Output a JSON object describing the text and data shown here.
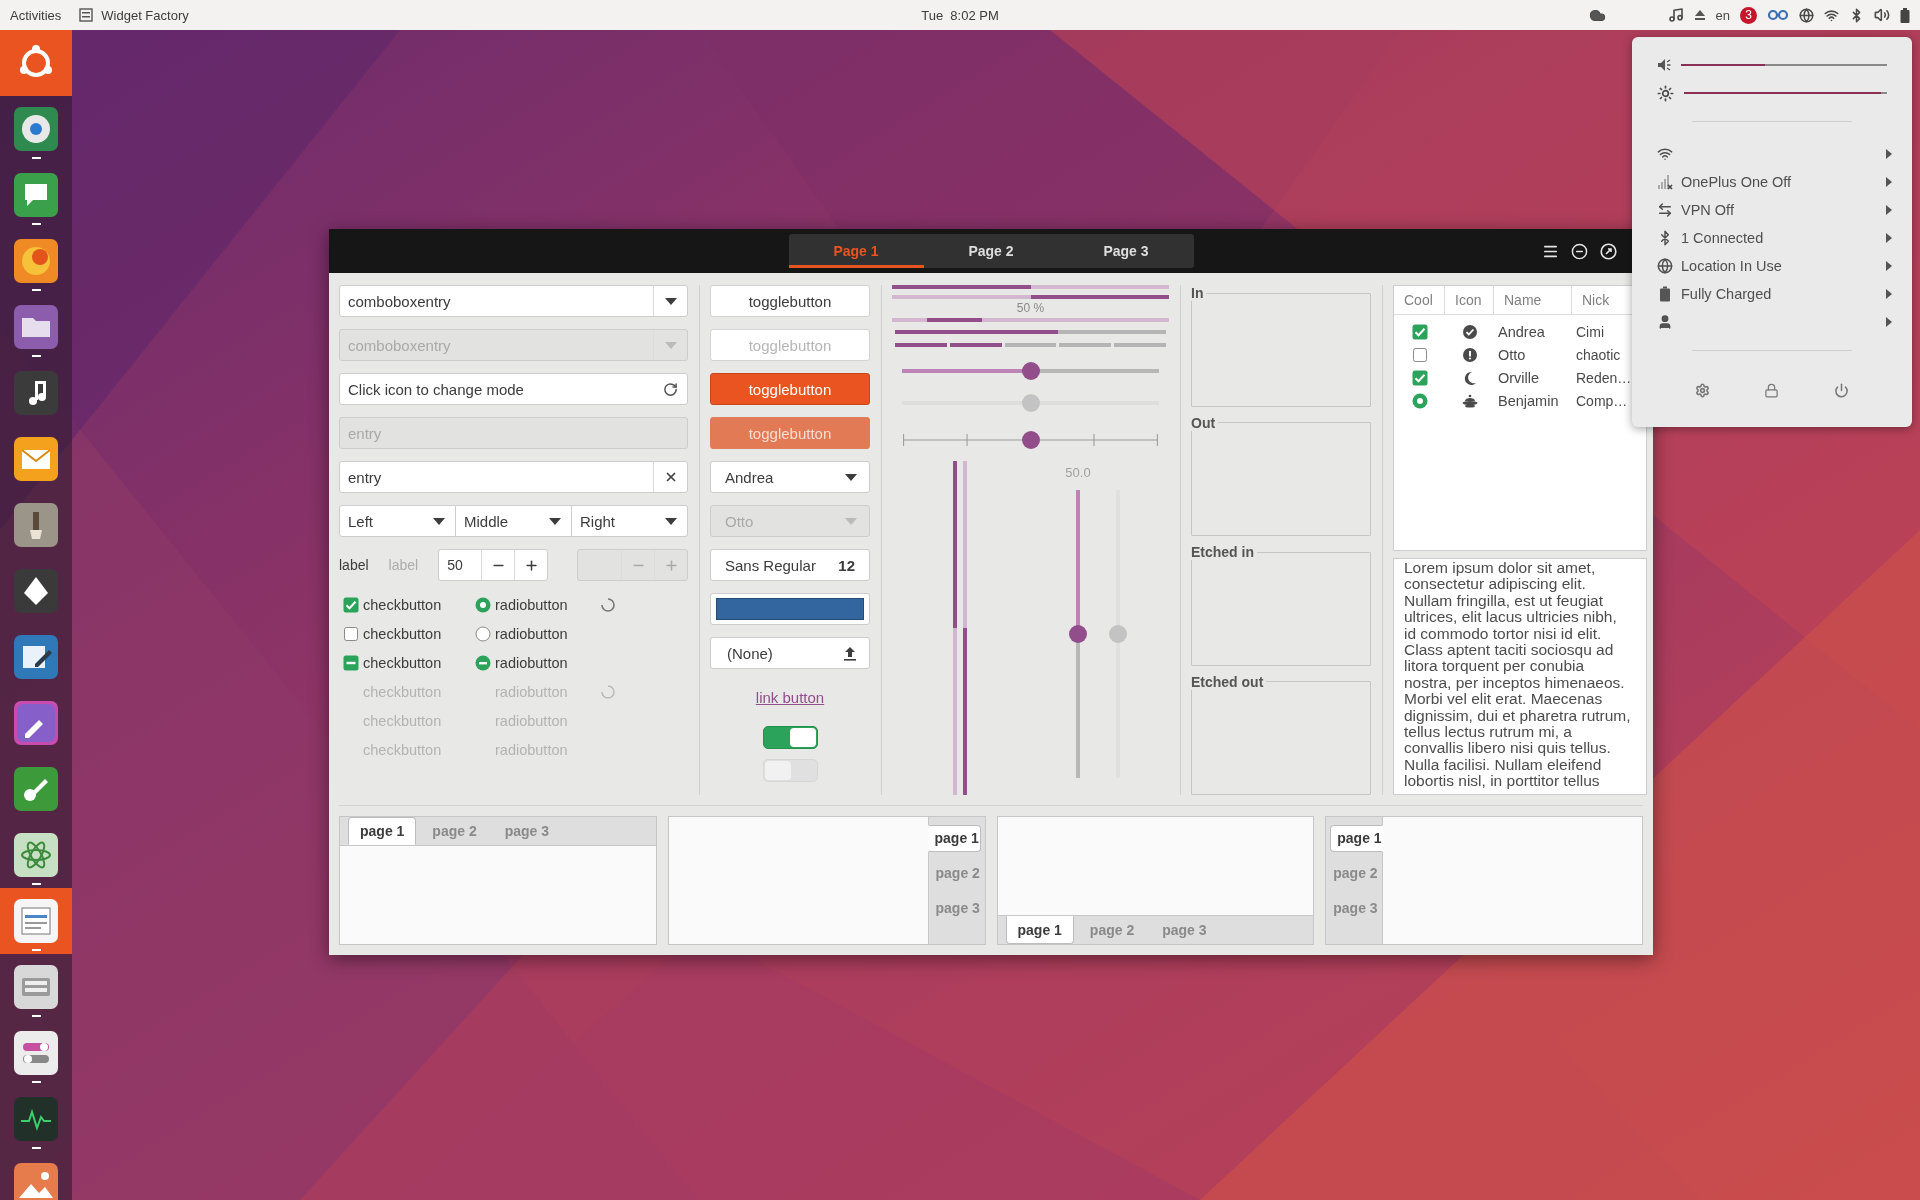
{
  "top_bar": {
    "activities": "Activities",
    "app_menu": "Widget Factory",
    "clock": "Tue  8:02 PM",
    "keyboard_layout": "en",
    "notification_badge": "3"
  },
  "launcher": [
    {
      "kind": "home",
      "running": false
    },
    {
      "kind": "app",
      "running": true,
      "focused": false
    },
    {
      "kind": "app",
      "running": true,
      "focused": false
    },
    {
      "kind": "app",
      "running": true,
      "focused": false
    },
    {
      "kind": "app",
      "running": true,
      "focused": false
    },
    {
      "kind": "app",
      "running": false,
      "focused": false
    },
    {
      "kind": "app",
      "running": false,
      "focused": false
    },
    {
      "kind": "app",
      "running": false,
      "focused": false
    },
    {
      "kind": "app",
      "running": false,
      "focused": false
    },
    {
      "kind": "app",
      "running": false,
      "focused": false
    },
    {
      "kind": "app",
      "running": false,
      "focused": false
    },
    {
      "kind": "app",
      "running": false,
      "focused": false
    },
    {
      "kind": "app",
      "running": true,
      "focused": false
    },
    {
      "kind": "app",
      "running": true,
      "focused": true
    },
    {
      "kind": "app",
      "running": true,
      "focused": false
    },
    {
      "kind": "app",
      "running": true,
      "focused": false
    },
    {
      "kind": "app",
      "running": true,
      "focused": false
    },
    {
      "kind": "app",
      "focused": false
    }
  ],
  "window": {
    "tabs": [
      {
        "label": "Page 1",
        "selected": true
      },
      {
        "label": "Page 2",
        "selected": false
      },
      {
        "label": "Page 3",
        "selected": false
      }
    ]
  },
  "combo_entries": [
    {
      "value": "comboboxentry",
      "disabled": false
    },
    {
      "value": "comboboxentry",
      "disabled": true
    }
  ],
  "entries": [
    {
      "kind": "icon",
      "value": "Click icon to change mode",
      "disabled": false
    },
    {
      "kind": "plain",
      "value": "entry",
      "disabled": true
    },
    {
      "kind": "clear",
      "value": "entry",
      "disabled": false
    }
  ],
  "linked_combos": [
    {
      "label": "Left"
    },
    {
      "label": "Middle"
    },
    {
      "label": "Right"
    }
  ],
  "labels": [
    {
      "text": "label",
      "disabled": false
    },
    {
      "text": "label",
      "disabled": true
    }
  ],
  "spin_buttons": [
    {
      "value": "50",
      "disabled": false
    },
    {
      "disabled": true
    }
  ],
  "checks": [
    {
      "label": "checkbutton",
      "checked": true,
      "inconsistent": false,
      "disabled": false
    },
    {
      "label": "checkbutton",
      "checked": false,
      "inconsistent": false,
      "disabled": false
    },
    {
      "label": "checkbutton",
      "checked": false,
      "inconsistent": true,
      "disabled": false
    },
    {
      "label": "checkbutton",
      "disabled": true
    },
    {
      "label": "checkbutton",
      "disabled": true
    },
    {
      "label": "checkbutton",
      "disabled": true
    }
  ],
  "radios": [
    {
      "label": "radiobutton",
      "checked": true,
      "inconsistent": false,
      "disabled": false
    },
    {
      "label": "radiobutton",
      "checked": false,
      "inconsistent": false,
      "disabled": false
    },
    {
      "label": "radiobutton",
      "checked": false,
      "inconsistent": true,
      "disabled": false
    },
    {
      "label": "radiobutton",
      "disabled": true
    },
    {
      "label": "radiobutton",
      "disabled": true
    },
    {
      "label": "radiobutton",
      "disabled": true
    }
  ],
  "spinners": [
    {
      "disabled": false
    },
    {
      "disabled": true
    }
  ],
  "toggle_buttons": [
    {
      "label": "togglebutton",
      "active": false,
      "disabled": false
    },
    {
      "label": "togglebutton",
      "active": false,
      "disabled": true
    },
    {
      "label": "togglebutton",
      "active": true,
      "disabled": false
    },
    {
      "label": "togglebutton",
      "active": true,
      "disabled": true
    }
  ],
  "combos": [
    {
      "value": "Andrea",
      "disabled": false
    },
    {
      "value": "Otto",
      "disabled": true
    }
  ],
  "font_button": {
    "family": "Sans Regular",
    "size": "12"
  },
  "color_button": {
    "color": "#33669e"
  },
  "file_button": {
    "label": "(None)"
  },
  "link_button": {
    "label": "link button"
  },
  "switches": [
    {
      "on": true,
      "disabled": false
    },
    {
      "on": false,
      "disabled": true
    }
  ],
  "progress_bars": [
    {
      "kind": "progress",
      "level": 0.5,
      "inverted": false
    },
    {
      "kind": "progress",
      "level": 0.5,
      "inverted": true
    },
    {
      "kind": "pulse",
      "text": "50 %",
      "level": 0.2
    },
    {
      "kind": "level",
      "level": 0.6
    },
    {
      "kind": "segments",
      "level": 0.4
    }
  ],
  "scales": [
    {
      "level": 0.5,
      "disabled": false,
      "marks": false
    },
    {
      "level": 0.5,
      "disabled": true,
      "marks": false
    },
    {
      "level": 0.5,
      "disabled": false,
      "marks": true
    }
  ],
  "vertical_progress": [
    {
      "level": 0.5,
      "inverted": false
    },
    {
      "level": 0.5,
      "inverted": true
    }
  ],
  "vertical_scales": [
    {
      "level": 0.5,
      "value": "50.0",
      "disabled": false
    },
    {
      "level": 0.5,
      "disabled": true
    }
  ],
  "frames": [
    {
      "label": "In"
    },
    {
      "label": "Out"
    },
    {
      "label": "Etched in"
    },
    {
      "label": "Etched out"
    }
  ],
  "tree": {
    "columns": [
      "Cool",
      "Icon",
      "Name",
      "Nick"
    ],
    "rows": [
      {
        "kind": "check",
        "checked": true,
        "name": "Andrea",
        "nick": "Cimi"
      },
      {
        "kind": "check",
        "checked": false,
        "name": "Otto",
        "nick": "chaotic"
      },
      {
        "kind": "check",
        "checked": true,
        "name": "Orville",
        "nick": "Reden…"
      },
      {
        "kind": "radio",
        "checked": true,
        "name": "Benjamin",
        "nick": "Comp…"
      }
    ]
  },
  "text_view": {
    "text": "Lorem ipsum dolor sit amet, consectetur adipiscing elit. Nullam fringilla, est ut feugiat ultrices, elit lacus ultricies nibh, id commodo tortor nisi id elit. Class aptent taciti sociosqu ad litora torquent per conubia nostra, per inceptos himenaeos. Morbi vel elit erat. Maecenas dignissim, dui et pharetra rutrum, tellus lectus rutrum mi, a convallis libero nisi quis tellus. Nulla facilisi. Nullam eleifend lobortis nisl, in porttitor tellus"
  },
  "notebooks": [
    {
      "kind": "top",
      "tabs": [
        {
          "label": "page 1",
          "selected": true
        },
        {
          "label": "page 2",
          "selected": false
        },
        {
          "label": "page 3",
          "selected": false
        }
      ]
    },
    {
      "kind": "right",
      "tabs": [
        {
          "label": "page 1",
          "selected": true
        },
        {
          "label": "page 2",
          "selected": false
        },
        {
          "label": "page 3",
          "selected": false
        }
      ]
    },
    {
      "kind": "bottom",
      "tabs": [
        {
          "label": "page 1",
          "selected": true
        },
        {
          "label": "page 2",
          "selected": false
        },
        {
          "label": "page 3",
          "selected": false
        }
      ]
    },
    {
      "kind": "left",
      "tabs": [
        {
          "label": "page 1",
          "selected": true
        },
        {
          "label": "page 2",
          "selected": false
        },
        {
          "label": "page 3",
          "selected": false
        }
      ]
    }
  ],
  "system_menu": {
    "sliders": [
      {
        "kind": "volume",
        "level": 0.41
      },
      {
        "kind": "brightness",
        "level": 0.97
      }
    ],
    "items": [
      {
        "kind": "wifi"
      },
      {
        "kind": "cellular",
        "label": "OnePlus One Off"
      },
      {
        "kind": "vpn",
        "label": "VPN Off"
      },
      {
        "kind": "bluetooth",
        "label": "1 Connected"
      },
      {
        "kind": "location",
        "label": "Location In Use"
      },
      {
        "kind": "battery",
        "label": "Fully Charged"
      },
      {
        "kind": "user"
      }
    ]
  }
}
